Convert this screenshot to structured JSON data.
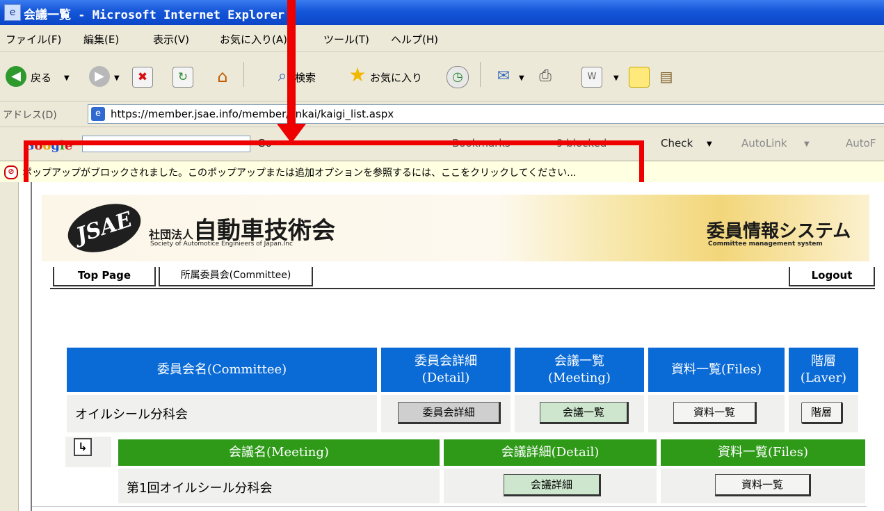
{
  "window": {
    "title": "会議一覧 - Microsoft Internet Explorer"
  },
  "menu": [
    "ファイル(F)",
    "編集(E)",
    "表示(V)",
    "お気に入り(A)",
    "ツール(T)",
    "ヘルプ(H)"
  ],
  "toolbar": {
    "back": "戻る",
    "search": "検索",
    "favorites": "お気に入り"
  },
  "address": {
    "label": "アドレス(D)",
    "url": "https://member.jsae.info/member/iinkai/kaigi_list.aspx"
  },
  "google_toolbar": {
    "logo": "Google",
    "go": "Go",
    "bookmarks": "Bookmarks",
    "blocked": "9 blocked",
    "check": "Check",
    "autolink": "AutoLink",
    "autofill": "AutoF"
  },
  "infobar": {
    "message": "ポップアップがブロックされました。このポップアップまたは追加オプションを参照するには、ここをクリックしてください..."
  },
  "banner": {
    "org_small": "社団法人",
    "org_name": "自動車技術会",
    "org_sub": "Society of Automotice Enginieers of Japan.Inc",
    "system_name": "委員情報システム",
    "system_sub": "Committee management system"
  },
  "nav": {
    "top_page": "Top Page",
    "committee": "所属委員会(Committee)",
    "logout": "Logout"
  },
  "committee_table": {
    "headers": {
      "name": "委員会名(Committee)",
      "detail_1": "委員会詳細",
      "detail_2": "(Detail)",
      "meeting_1": "会議一覧",
      "meeting_2": "(Meeting)",
      "files": "資料一覧(Files)",
      "layer_1": "階層",
      "layer_2": "(Laver)"
    },
    "row": {
      "name": "オイルシール分科会",
      "detail_btn": "委員会詳細",
      "meeting_btn": "会議一覧",
      "files_btn": "資料一覧",
      "layer_btn": "階層"
    }
  },
  "meeting_table": {
    "headers": {
      "name": "会議名(Meeting)",
      "detail": "会議詳細(Detail)",
      "files": "資料一覧(Files)"
    },
    "row": {
      "name": "第1回オイルシール分科会",
      "detail_btn": "会議詳細",
      "files_btn": "資料一覧"
    }
  },
  "colors": {
    "title_bar": "#1556d8",
    "committee_header": "#0a6bd6",
    "meeting_header": "#2e9a18",
    "annotation": "#ee0000",
    "infobar": "#ffffe1"
  },
  "icons": [
    "ie-page-icon",
    "back-icon",
    "forward-icon",
    "stop-icon",
    "refresh-icon",
    "home-icon",
    "search-icon",
    "favorites-star-icon",
    "history-icon",
    "mail-icon",
    "print-icon",
    "edit-icon",
    "folder-icon",
    "popup-blocked-icon",
    "jsae-logo",
    "sub-level-arrow-icon"
  ]
}
